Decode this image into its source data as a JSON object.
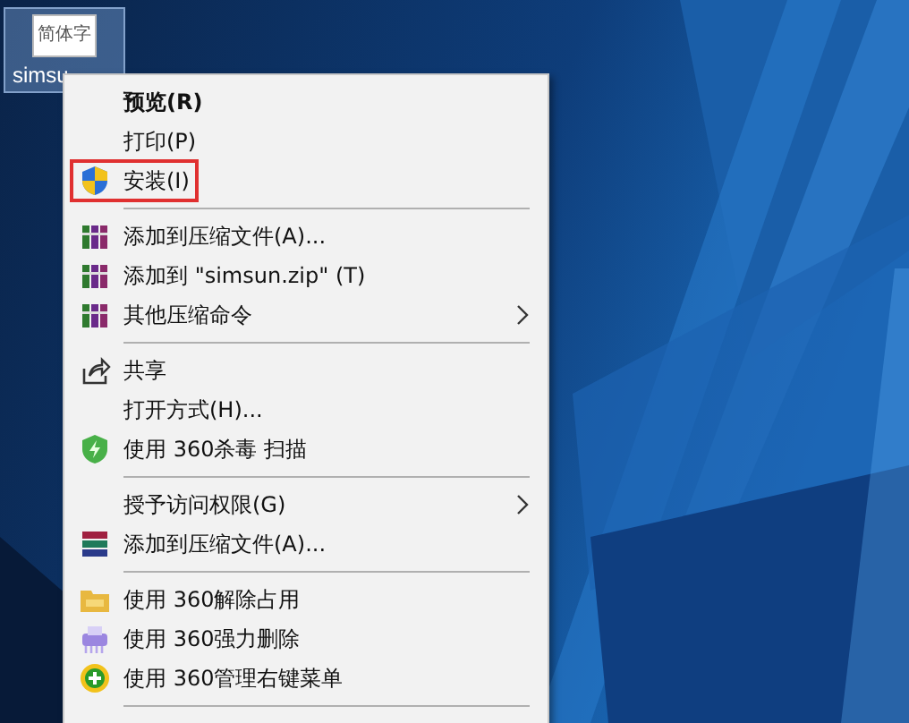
{
  "desktop_icon": {
    "image_text": "简体字",
    "label": "simsu",
    "selected": true
  },
  "context_menu": {
    "items": [
      {
        "kind": "plain",
        "label": "预览(R)",
        "default": true
      },
      {
        "kind": "plain",
        "label": "打印(P)"
      },
      {
        "kind": "install",
        "label": "安装(I)",
        "highlighted": true
      },
      {
        "kind": "separator"
      },
      {
        "kind": "books",
        "label": "添加到压缩文件(A)..."
      },
      {
        "kind": "books",
        "label": "添加到 \"simsun.zip\" (T)"
      },
      {
        "kind": "books",
        "label": "其他压缩命令",
        "submenu": true
      },
      {
        "kind": "separator"
      },
      {
        "kind": "share",
        "label": "共享"
      },
      {
        "kind": "plain",
        "label": "打开方式(H)..."
      },
      {
        "kind": "antivirus",
        "label": "使用 360杀毒 扫描"
      },
      {
        "kind": "separator"
      },
      {
        "kind": "plain",
        "label": "授予访问权限(G)",
        "submenu": true
      },
      {
        "kind": "stack",
        "label": "添加到压缩文件(A)..."
      },
      {
        "kind": "separator"
      },
      {
        "kind": "folder",
        "label": "使用 360解除占用"
      },
      {
        "kind": "shredder",
        "label": "使用 360强力删除"
      },
      {
        "kind": "plus",
        "label": "使用 360管理右键菜单"
      },
      {
        "kind": "separator"
      }
    ]
  }
}
